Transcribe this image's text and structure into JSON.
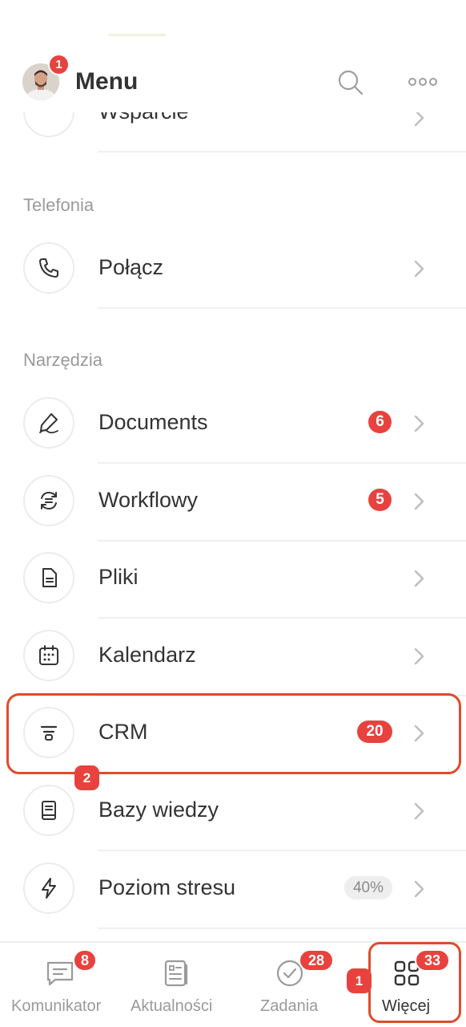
{
  "header": {
    "title": "Menu",
    "avatar_badge": "1",
    "search_icon": "search-icon",
    "more_icon": "more-horizontal-icon"
  },
  "partial_item": {
    "label": "Wsparcie",
    "icon": "chat-bubble-icon"
  },
  "sections": [
    {
      "title": "Telefonia",
      "items": [
        {
          "label": "Połącz",
          "icon": "phone-icon"
        }
      ]
    },
    {
      "title": "Narzędzia",
      "items": [
        {
          "label": "Documents",
          "icon": "signature-pen-icon",
          "counter": "6"
        },
        {
          "label": "Workflowy",
          "icon": "workflow-cycle-icon",
          "counter": "5"
        },
        {
          "label": "Pliki",
          "icon": "file-icon"
        },
        {
          "label": "Kalendarz",
          "icon": "calendar-icon"
        },
        {
          "label": "CRM",
          "icon": "funnel-icon",
          "counter": "20"
        },
        {
          "label": "Bazy wiedzy",
          "icon": "book-icon"
        },
        {
          "label": "Poziom stresu",
          "icon": "lightning-icon",
          "percent": "40%"
        }
      ]
    }
  ],
  "annotations": {
    "step_1": "1",
    "step_2": "2"
  },
  "tabbar": [
    {
      "label": "Komunikator",
      "icon": "chat-icon",
      "badge": "8"
    },
    {
      "label": "Aktualności",
      "icon": "news-icon"
    },
    {
      "label": "Zadania",
      "icon": "check-circle-icon",
      "badge": "28"
    },
    {
      "label": "Więcej",
      "icon": "grid-icon",
      "badge": "33",
      "active": true
    }
  ],
  "colors": {
    "accent_red": "#e8423f",
    "highlight_border": "#e04b2a",
    "text_primary": "#333333",
    "text_secondary": "#9a9a9a"
  }
}
